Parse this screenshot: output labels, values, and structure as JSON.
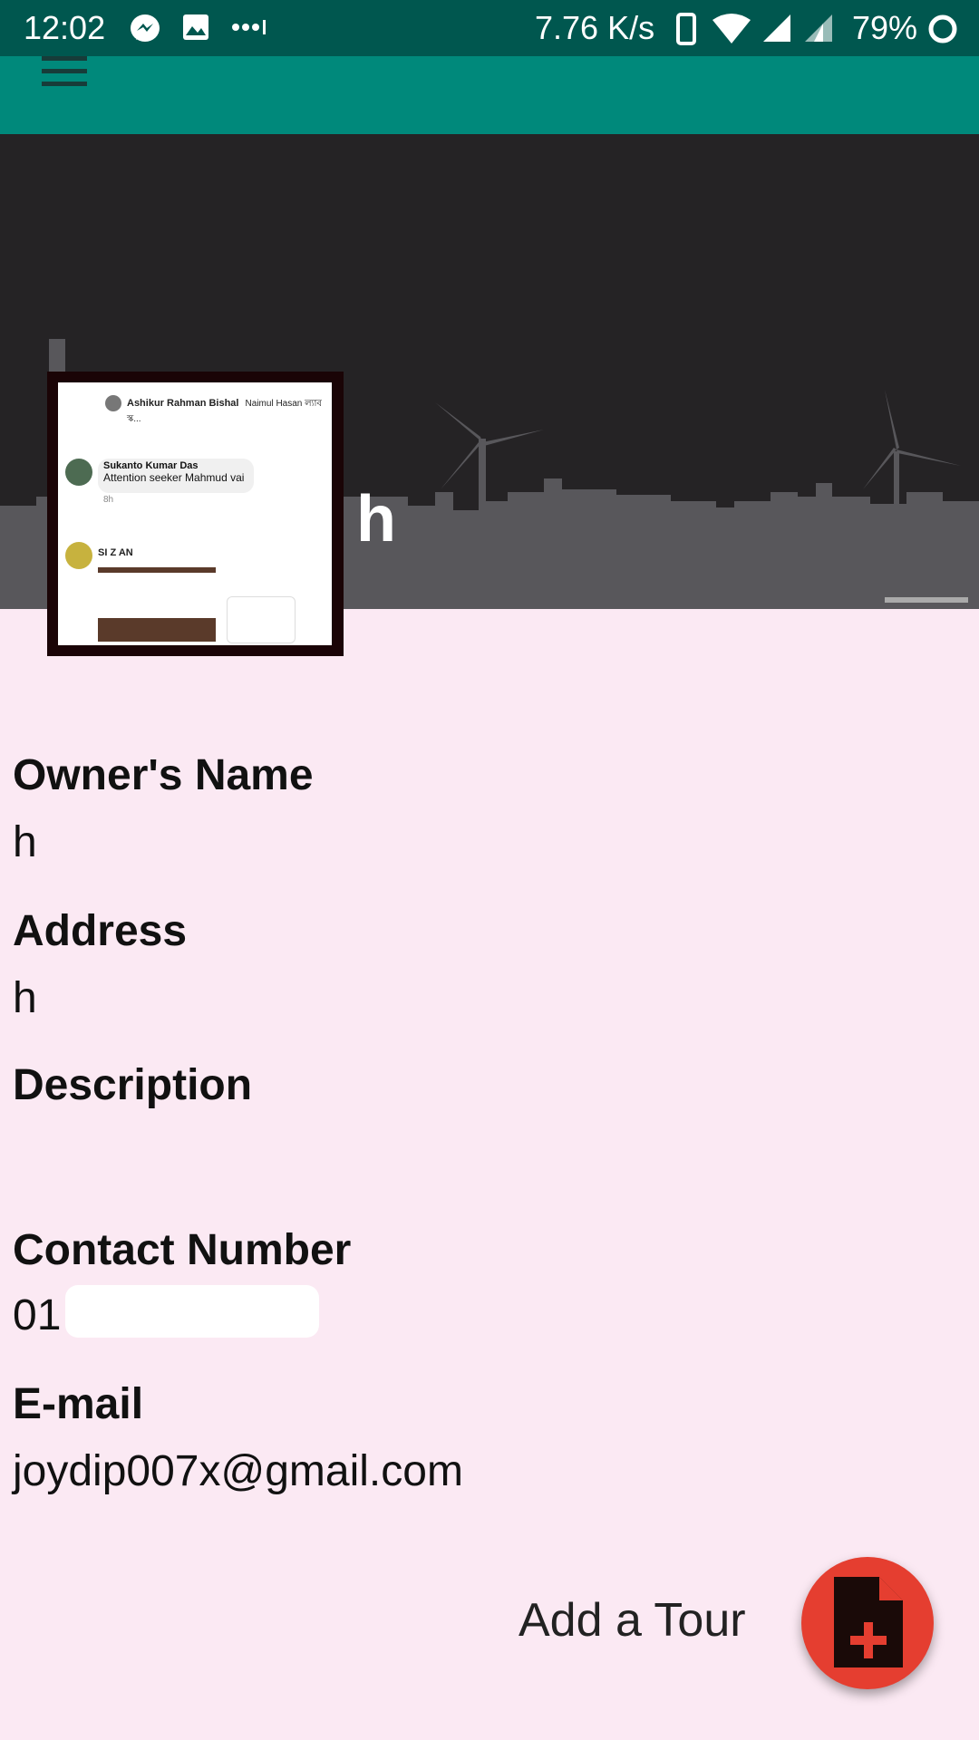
{
  "status_bar": {
    "time": "12:02",
    "network_speed": "7.76 K/s",
    "battery": "79%",
    "icons": [
      "messenger-icon",
      "gallery-icon",
      "more-dots-icon",
      "phone-icon",
      "wifi-icon",
      "signal-icon",
      "signal-icon-2",
      "battery-circle-icon"
    ]
  },
  "toolbar": {
    "menu_icon": "hamburger-menu-icon",
    "color": "#00897b"
  },
  "header": {
    "title": "h",
    "background_color": "#252325"
  },
  "profile_image": {
    "post1_name": "Ashikur Rahman Bishal",
    "post1_text": "Naimul Hasan ল্যাব স্ক...",
    "post2_name": "Sukanto Kumar Das",
    "post2_text": "Attention seeker Mahmud vai",
    "post2_time": "8h",
    "post3_name": "SI Z AN"
  },
  "details": {
    "owner_label": "Owner's Name",
    "owner_value": "h",
    "address_label": "Address",
    "address_value": "h",
    "description_label": "Description",
    "description_value": "",
    "contact_label": "Contact Number",
    "contact_value": "01",
    "email_label": "E-mail",
    "email_value": "joydip007x@gmail.com"
  },
  "actions": {
    "add_tour_label": "Add a Tour",
    "fab_icon": "add-document-icon",
    "fab_color": "#e53e30"
  }
}
